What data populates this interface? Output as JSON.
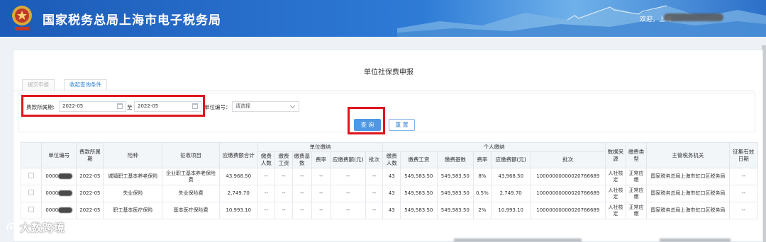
{
  "header": {
    "title": "国家税务总局上海市电子税务局",
    "welcome": "欢迎，上海"
  },
  "page": {
    "title": "单位社保费申报"
  },
  "tabs": [
    {
      "label": "提交申报"
    },
    {
      "label": "收起查询条件"
    }
  ],
  "filters": {
    "period_label": "费款所属期:",
    "period_start": "2022-05",
    "period_sep": "至",
    "period_end": "2022-05",
    "unit_code_label": "单位编号：",
    "unit_code_select": "请选择",
    "query_button": "查 询",
    "reset_button": "重 置"
  },
  "table": {
    "headers": {
      "unit_code": "单位编号",
      "period": "费款所属期",
      "insurance": "险种",
      "item": "征收项目",
      "payable_total": "应缴费额合计",
      "unit_group": "单位缴纳",
      "personal_group": "个人缴纳",
      "data_source": "数据来源",
      "fee_type": "缴费类型",
      "tax_office": "主管税务机关",
      "valid_date": "征集有效日期"
    },
    "unit_sub": [
      "缴费人数",
      "缴费工资",
      "缴费基数",
      "费率",
      "应缴费额(元)",
      "批次"
    ],
    "personal_sub": [
      "缴费人数",
      "缴费工资",
      "缴费基数",
      "费率",
      "应缴费额(元)",
      "批次"
    ],
    "rows": [
      {
        "unit_code": "0000",
        "period": "2022-05",
        "insurance": "城镇职工基本养老保险",
        "item": "企业职工基本养老保险费",
        "payable_total": "43,968.50",
        "u_count": "--",
        "u_wage": "--",
        "u_base": "--",
        "u_rate": "--",
        "u_amount": "--",
        "u_batch": "--",
        "p_count": "43",
        "p_wage": "549,583.50",
        "p_base": "549,583.50",
        "p_rate": "8%",
        "p_amount": "43,968.50",
        "p_batch": "10000000000020766689",
        "source": "人社核定",
        "fee_type": "正常应缴",
        "office": "国家税务总局上海市虹口区税务局",
        "valid": "--"
      },
      {
        "unit_code": "0000",
        "period": "2022-05",
        "insurance": "失业保险",
        "item": "失业保险费",
        "payable_total": "2,749.70",
        "u_count": "--",
        "u_wage": "--",
        "u_base": "--",
        "u_rate": "--",
        "u_amount": "--",
        "u_batch": "--",
        "p_count": "43",
        "p_wage": "549,583.50",
        "p_base": "549,583.50",
        "p_rate": "0.5%",
        "p_amount": "2,749.70",
        "p_batch": "10000000000020766689",
        "source": "人社核定",
        "fee_type": "正常应缴",
        "office": "国家税务总局上海市虹口区税务局",
        "valid": "--"
      },
      {
        "unit_code": "0000",
        "period": "2022-05",
        "insurance": "职工基本医疗保险",
        "item": "基本医疗保险费",
        "payable_total": "10,993.10",
        "u_count": "--",
        "u_wage": "--",
        "u_base": "--",
        "u_rate": "--",
        "u_amount": "--",
        "u_batch": "--",
        "p_count": "43",
        "p_wage": "549,583.50",
        "p_base": "549,583.50",
        "p_rate": "2%",
        "p_amount": "10,993.10",
        "p_batch": "10000000000020766689",
        "source": "人社核定",
        "fee_type": "正常应缴",
        "office": "国家税务总局上海市虹口区税务局",
        "valid": "--"
      }
    ]
  },
  "watermark": {
    "text": "大数跨境"
  },
  "colors": {
    "header_blue": "#1c5bb8",
    "primary_button": "#4e98e4",
    "highlight_red": "#e0141e"
  }
}
